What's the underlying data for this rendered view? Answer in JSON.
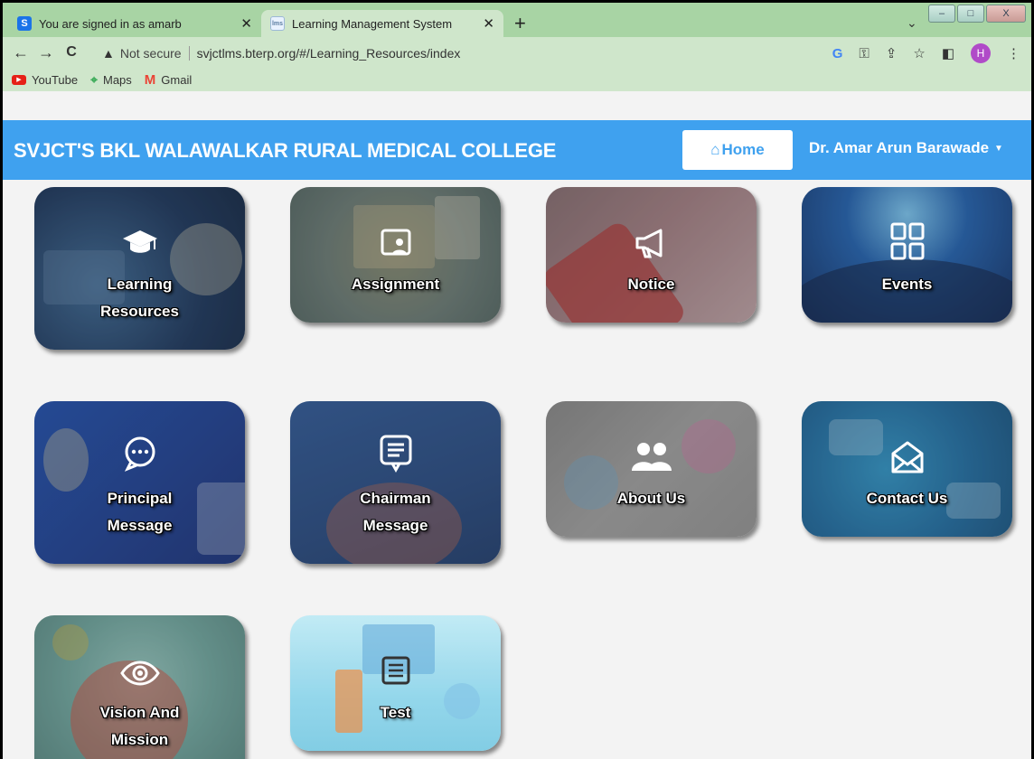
{
  "browser": {
    "tabs": [
      {
        "title": "You are signed in as amarb",
        "favicon": "S",
        "active": false
      },
      {
        "title": "Learning Management System",
        "favicon": "lms",
        "active": true
      }
    ],
    "new_tab": "+",
    "tab_menu": "chevron-down-icon",
    "window_controls": {
      "minimize": "–",
      "maximize": "□",
      "close": "X"
    },
    "nav": {
      "back": "←",
      "forward": "→",
      "reload": "C"
    },
    "security_label": "Not secure",
    "url": "svjctlms.bterp.org/#/Learning_Resources/index",
    "profile_initial": "H",
    "bookmarks": [
      {
        "label": "YouTube",
        "icon": "youtube-icon"
      },
      {
        "label": "Maps",
        "icon": "maps-icon"
      },
      {
        "label": "Gmail",
        "icon": "gmail-icon"
      }
    ]
  },
  "header": {
    "college_name": "SVJCT'S BKL WALAWALKAR RURAL MEDICAL COLLEGE",
    "home_label": "Home",
    "user_name": "Dr. Amar Arun Barawade",
    "accent_color": "#3fa1ef"
  },
  "tiles": [
    {
      "line1": "Learning",
      "line2": "Resources",
      "icon": "graduation-cap-icon"
    },
    {
      "line1": "Assignment",
      "line2": "",
      "icon": "assignment-icon"
    },
    {
      "line1": "Notice",
      "line2": "",
      "icon": "megaphone-icon"
    },
    {
      "line1": "Events",
      "line2": "",
      "icon": "grid-icon"
    },
    {
      "line1": "Principal",
      "line2": "Message",
      "icon": "chat-bubble-icon"
    },
    {
      "line1": "Chairman",
      "line2": "Message",
      "icon": "message-icon"
    },
    {
      "line1": "About Us",
      "line2": "",
      "icon": "users-icon"
    },
    {
      "line1": "Contact Us",
      "line2": "",
      "icon": "envelope-icon"
    },
    {
      "line1": "Vision And",
      "line2": "Mission",
      "icon": "eye-icon"
    },
    {
      "line1": "Test",
      "line2": "",
      "icon": "test-icon"
    }
  ]
}
